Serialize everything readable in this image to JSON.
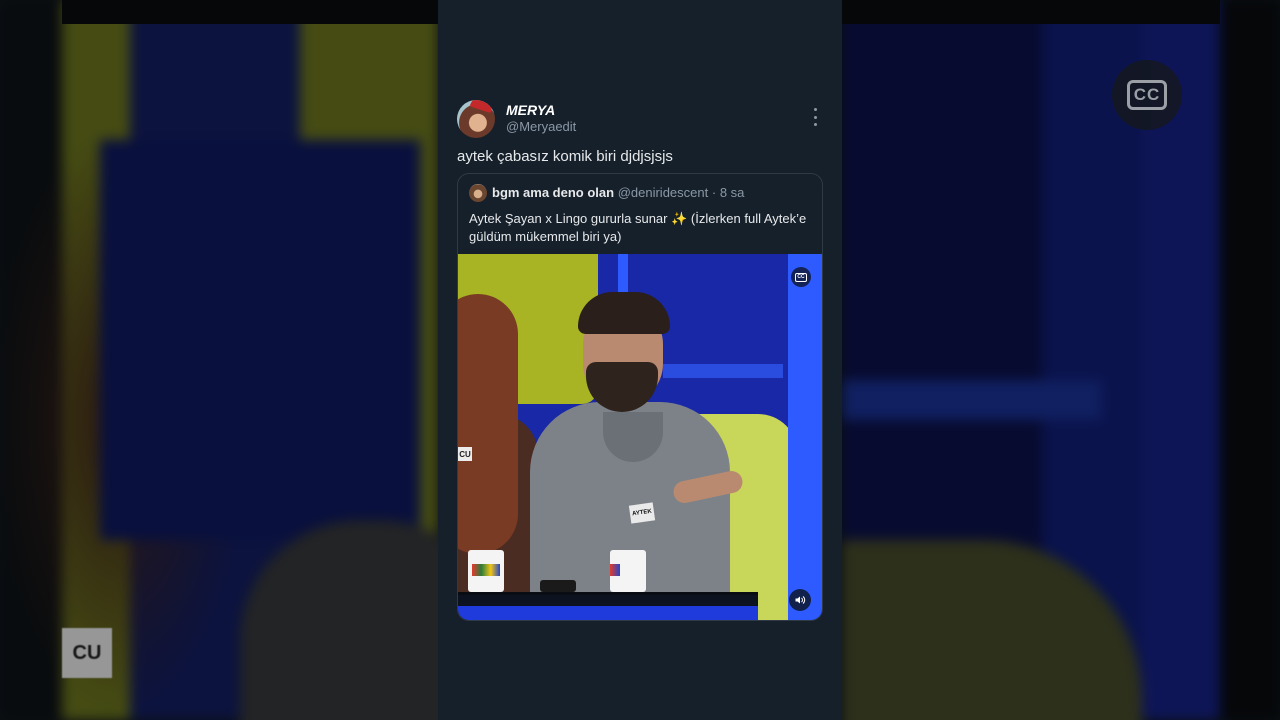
{
  "tweet": {
    "display_name": "MERYA",
    "handle": "@Meryaedit",
    "text": "aytek çabasız komik biri djdjsjsjs",
    "more_icon": "more-vertical-icon"
  },
  "quote": {
    "display_name": "bgm ama deno olan",
    "handle": "@deniridescent",
    "separator": "·",
    "time": "8 sa",
    "text": "Aytek Şayan x Lingo gururla sunar ✨ (İzlerken full Aytek’e güldüm mükemmel biri ya)",
    "video": {
      "cc_label": "CC",
      "name_tag_man": "AYTEK",
      "name_tag_woman": "CU"
    }
  },
  "background": {
    "cc_label": "CC",
    "tag_label": "CU"
  },
  "colors": {
    "card_bg": "#15202b",
    "text_primary": "#e7e9ea",
    "text_secondary": "#8b98a5",
    "border": "#2f3a45"
  }
}
